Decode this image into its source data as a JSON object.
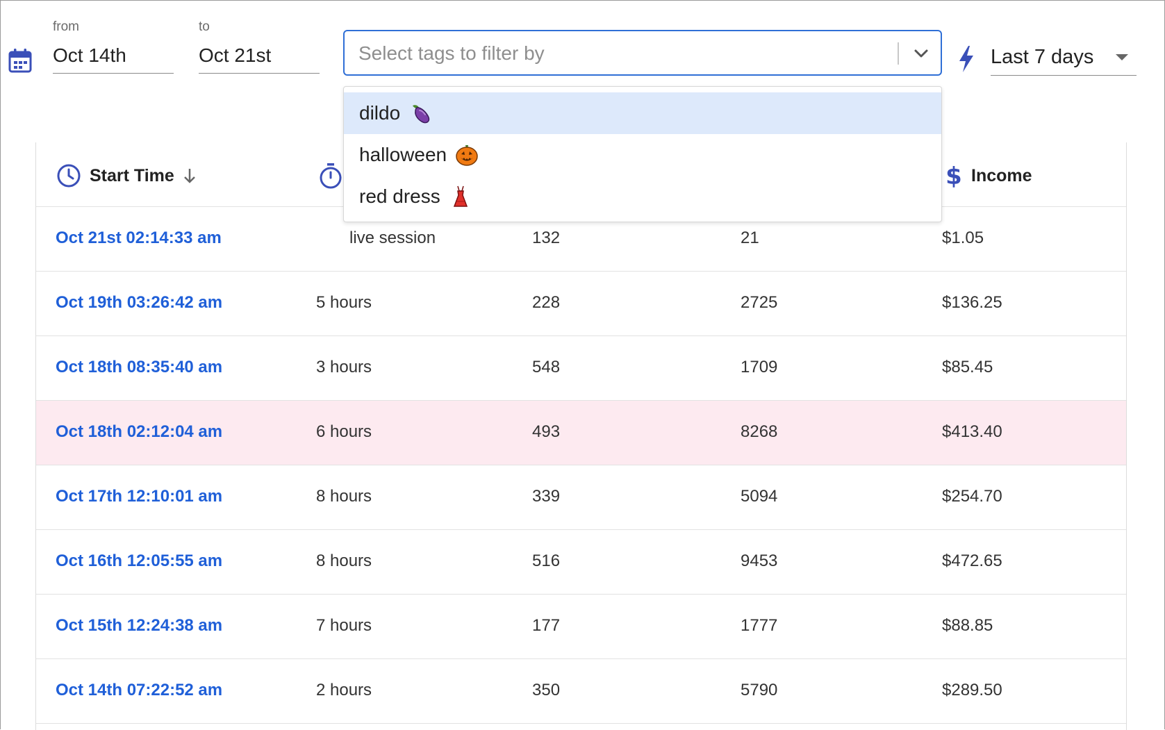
{
  "filters": {
    "from_label": "from",
    "from_value": "Oct 14th",
    "to_label": "to",
    "to_value": "Oct 21st",
    "tags_placeholder": "Select tags to filter by",
    "tag_options": [
      {
        "label": "dildo",
        "emoji": "eggplant-emoji"
      },
      {
        "label": "halloween",
        "emoji": "jack-o-lantern-emoji"
      },
      {
        "label": "red dress",
        "emoji": "dress-emoji"
      }
    ],
    "range_value": "Last 7 days"
  },
  "colors": {
    "accent": "#2f6fd6",
    "link": "#1f5fd8",
    "icon": "#3a4fb8",
    "selected_option": "#dde9fb",
    "highlight_row": "#fdeaf0"
  },
  "table": {
    "headers": {
      "start_time": "Start Time",
      "income": "Income"
    },
    "rows": [
      {
        "start": "Oct 21st 02:14:33 am",
        "duration": "live session",
        "col3": "132",
        "col4": "21",
        "income": "$1.05",
        "highlight": false
      },
      {
        "start": "Oct 19th 03:26:42 am",
        "duration": "5 hours",
        "col3": "228",
        "col4": "2725",
        "income": "$136.25",
        "highlight": false
      },
      {
        "start": "Oct 18th 08:35:40 am",
        "duration": "3 hours",
        "col3": "548",
        "col4": "1709",
        "income": "$85.45",
        "highlight": false
      },
      {
        "start": "Oct 18th 02:12:04 am",
        "duration": "6 hours",
        "col3": "493",
        "col4": "8268",
        "income": "$413.40",
        "highlight": true
      },
      {
        "start": "Oct 17th 12:10:01 am",
        "duration": "8 hours",
        "col3": "339",
        "col4": "5094",
        "income": "$254.70",
        "highlight": false
      },
      {
        "start": "Oct 16th 12:05:55 am",
        "duration": "8 hours",
        "col3": "516",
        "col4": "9453",
        "income": "$472.65",
        "highlight": false
      },
      {
        "start": "Oct 15th 12:24:38 am",
        "duration": "7 hours",
        "col3": "177",
        "col4": "1777",
        "income": "$88.85",
        "highlight": false
      },
      {
        "start": "Oct 14th 07:22:52 am",
        "duration": "2 hours",
        "col3": "350",
        "col4": "5790",
        "income": "$289.50",
        "highlight": false
      }
    ]
  }
}
